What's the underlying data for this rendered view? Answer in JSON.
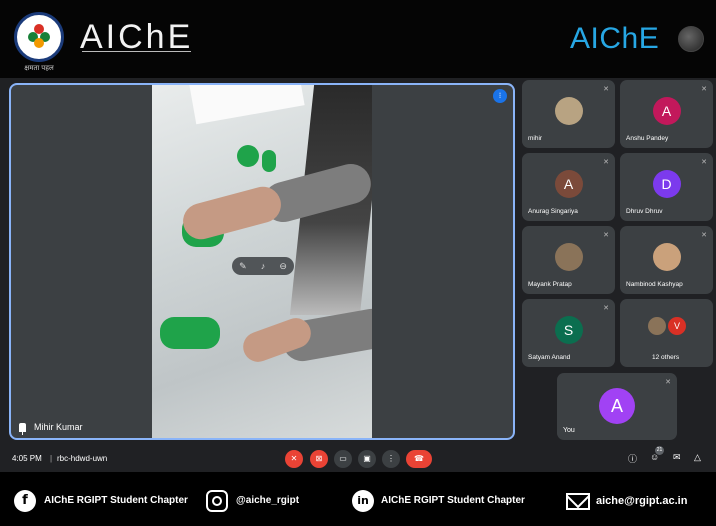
{
  "banner": {
    "left_brand": "AIChE",
    "logo_caption": "क्षमता पहल",
    "right_brand": "AIChE"
  },
  "main_video": {
    "participant_name": "Mihir Kumar"
  },
  "participants": [
    {
      "name": "mihir",
      "avatar": "",
      "color": "#b8a382",
      "photo": true
    },
    {
      "name": "Anshu Pandey",
      "avatar": "A",
      "color": "#c2185b",
      "photo": false
    },
    {
      "name": "Anurag Singariya",
      "avatar": "A",
      "color": "#7b4a3a",
      "photo": false
    },
    {
      "name": "Dhruv Dhruv",
      "avatar": "D",
      "color": "#7c3aed",
      "photo": false
    },
    {
      "name": "Mayank Pratap",
      "avatar": "",
      "color": "#8a7359",
      "photo": true
    },
    {
      "name": "Nambinod Kashyap",
      "avatar": "",
      "color": "#caa17b",
      "photo": true
    },
    {
      "name": "Satyam Anand",
      "avatar": "S",
      "color": "#0b6e4f",
      "photo": false
    },
    {
      "name": "12 others",
      "avatar": "V",
      "color": "#d93025",
      "photo": false
    }
  ],
  "self_tile": {
    "name": "You",
    "avatar": "A",
    "color": "#a142f4"
  },
  "bottom_bar": {
    "time": "4:05 PM",
    "separator": "|",
    "meeting_code": "rbc-hdwd-uwn",
    "participant_count": "21"
  },
  "footer": {
    "facebook_text": "AIChE RGIPT Student Chapter",
    "instagram_text": "@aiche_rgipt",
    "linkedin_text": "AIChE RGIPT Student Chapter",
    "email_text": "aiche@rgipt.ac.in",
    "facebook_glyph": "f",
    "linkedin_glyph": "in"
  },
  "colors": {
    "accent": "#8ab4f8",
    "end_call": "#ea4335",
    "brand_blue": "#27a7e4"
  }
}
